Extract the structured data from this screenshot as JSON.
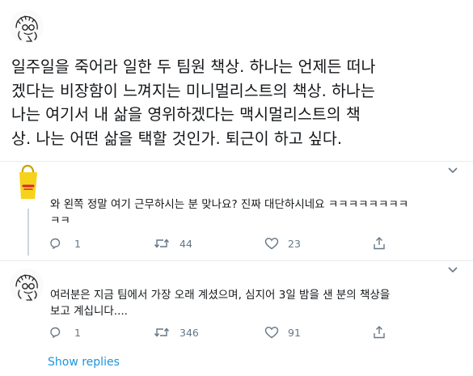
{
  "tweet": {
    "lines": [
      "일주일을 죽어라 일한 두 팀원 책상. 하나는 언제든 떠나",
      "겠다는 비장함이 느껴지는 미니멀리스트의 책상. 하나는",
      "나는 여기서 내 삶을 영위하겠다는 맥시멀리스트의 책",
      "상. 나는 어떤 삶을 택할 것인가. 퇴근이 하고 싶다."
    ]
  },
  "replies": [
    {
      "lines": [
        "와 왼쪽 정말 여기 근무하시는 분 맞나요? 진짜 대단하시네요 ㅋㅋㅋㅋㅋㅋㅋㅋ",
        "ㅋㅋ"
      ],
      "reply_count": "1",
      "retweet_count": "44",
      "like_count": "23"
    },
    {
      "lines": [
        "여러분은 지금 팀에서 가장 오래 계셨으며, 심지어 3일 밤을 샌 분의 책상을",
        "보고 계십니다...."
      ],
      "reply_count": "1",
      "retweet_count": "346",
      "like_count": "91"
    }
  ],
  "show_replies_label": "Show replies",
  "colors": {
    "link": "#1b95e0",
    "icon": "#657786",
    "divider": "#e6ecf0",
    "thread": "#ccd6dd"
  },
  "icons": [
    "reply-icon",
    "retweet-icon",
    "like-icon",
    "share-icon",
    "chevron-down-icon"
  ]
}
